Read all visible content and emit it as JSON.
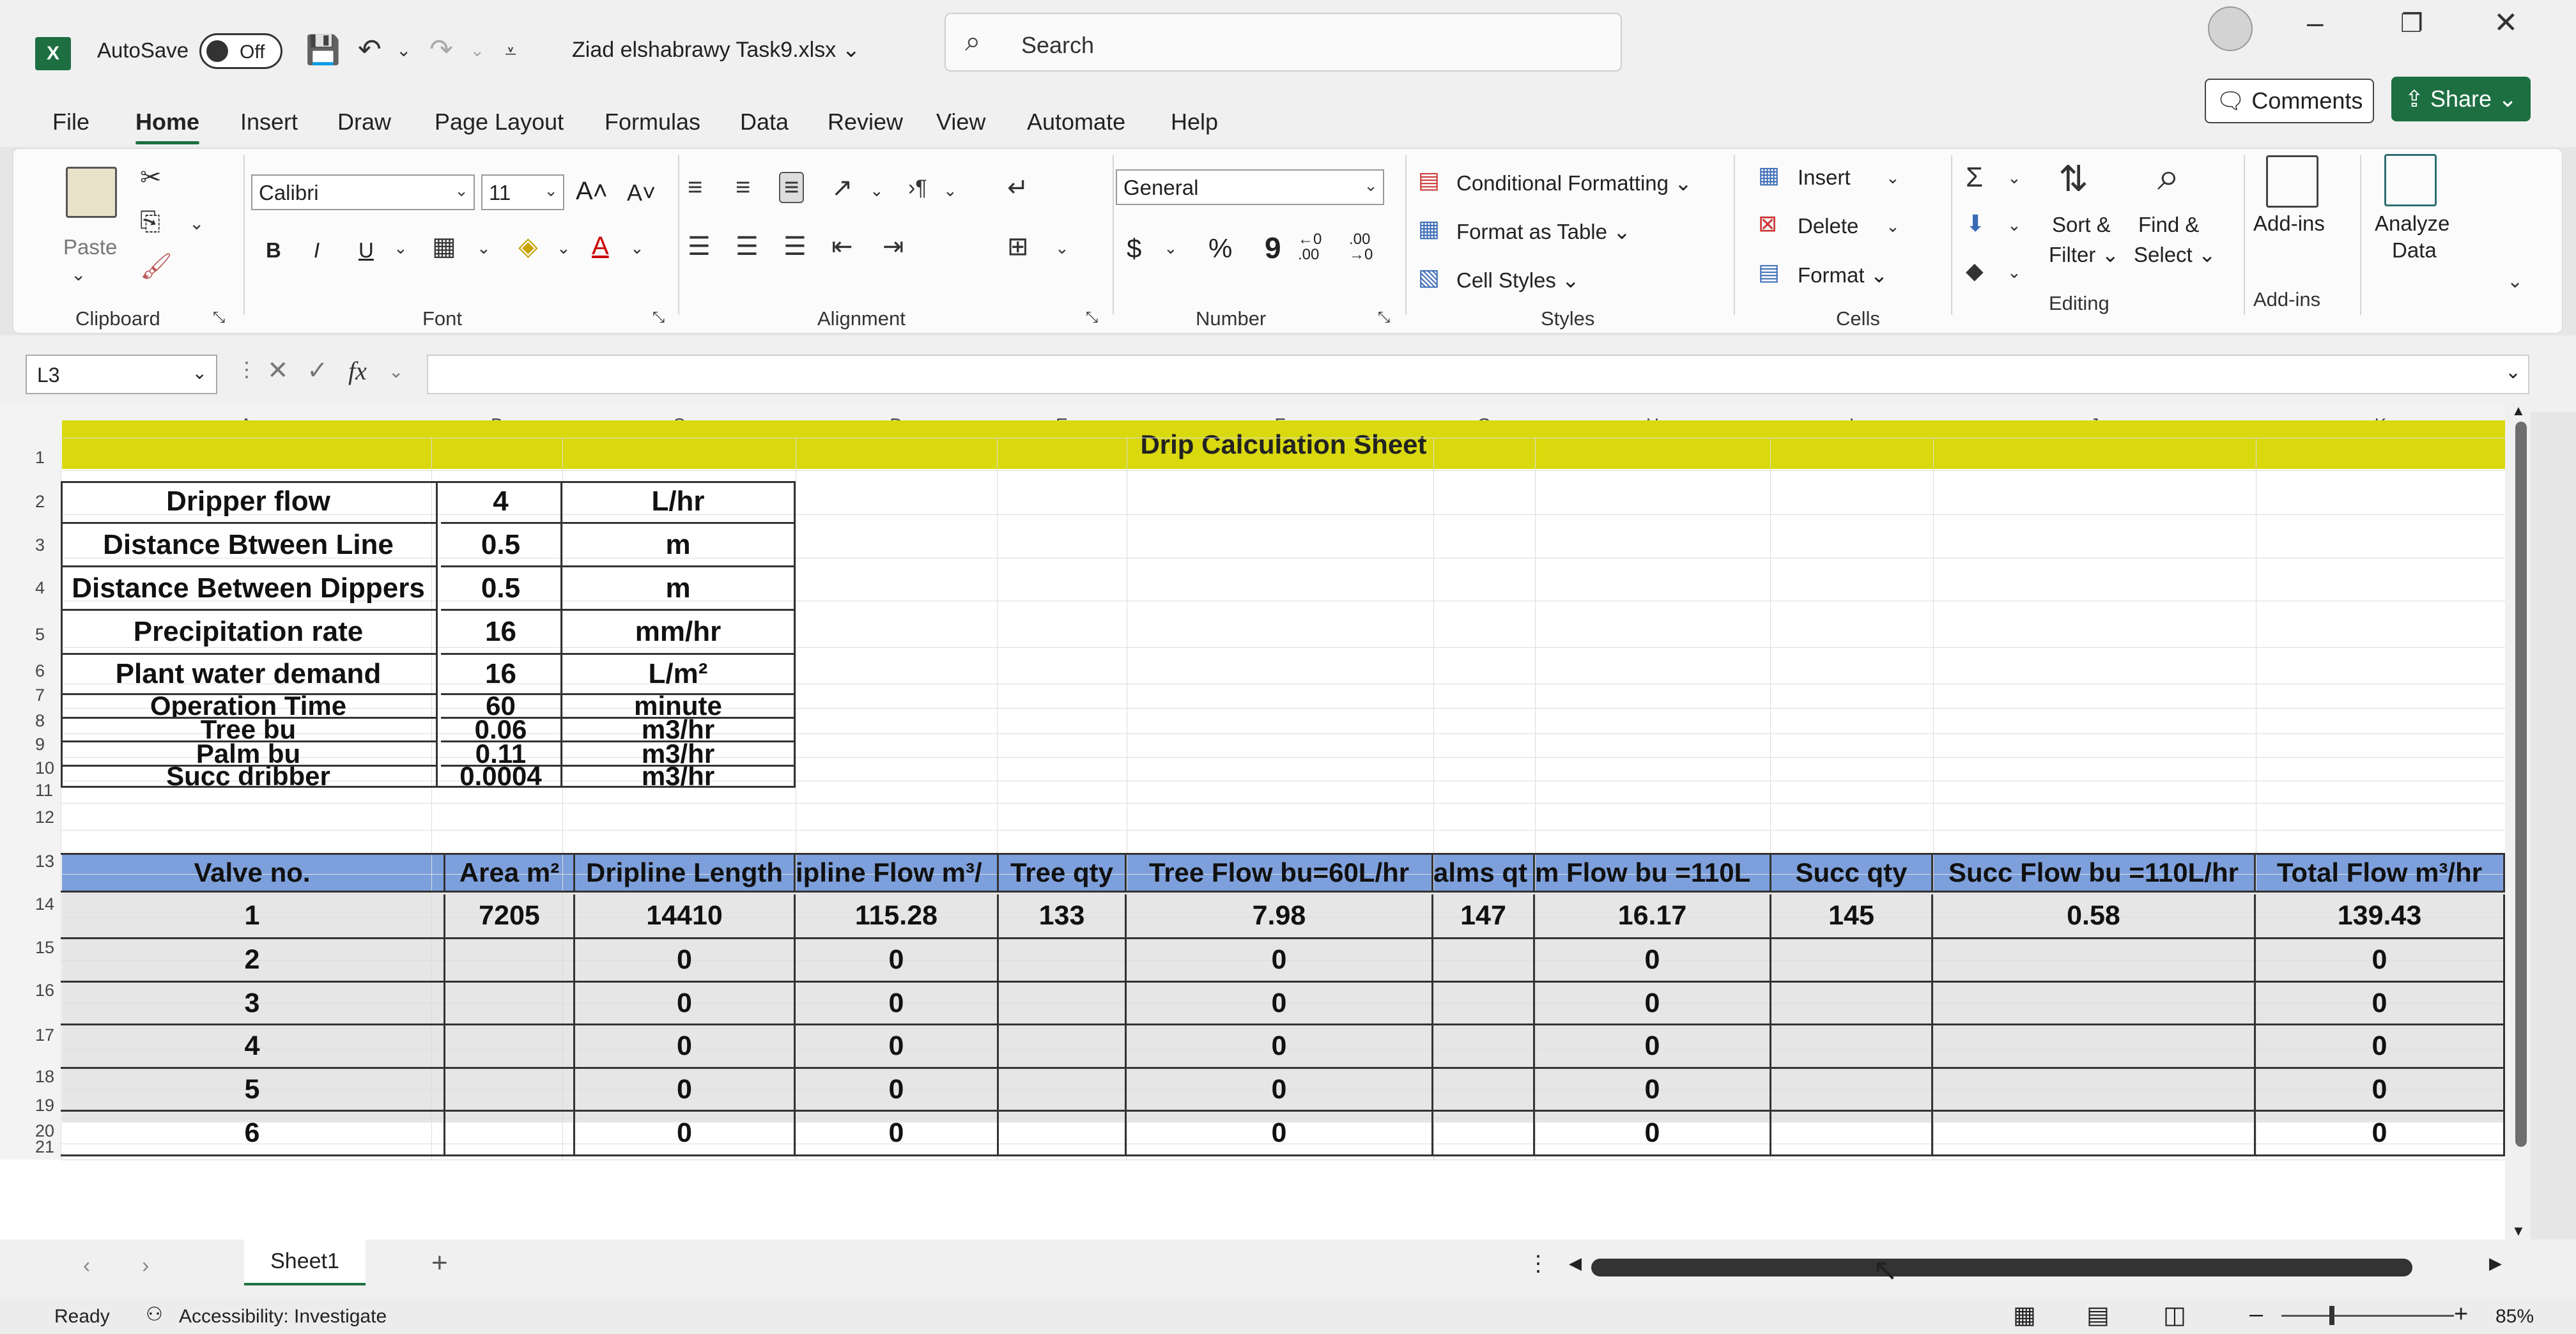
{
  "titlebar": {
    "app_icon": "X",
    "autosave_label": "AutoSave",
    "autosave_state": "Off",
    "filename": "Ziad elshabrawy Task9.xlsx",
    "search_placeholder": "Search"
  },
  "menu": {
    "tabs": [
      "File",
      "Home",
      "Insert",
      "Draw",
      "Page Layout",
      "Formulas",
      "Data",
      "Review",
      "View",
      "Automate",
      "Help"
    ],
    "active": "Home",
    "comments_label": "Comments",
    "share_label": "Share"
  },
  "ribbon": {
    "clipboard": {
      "paste": "Paste",
      "label": "Clipboard"
    },
    "font": {
      "name": "Calibri",
      "size": "11",
      "bold": "B",
      "italic": "I",
      "underline": "U",
      "label": "Font"
    },
    "alignment": {
      "label": "Alignment"
    },
    "number": {
      "format": "General",
      "currency": "$",
      "percent": "%",
      "comma": "9",
      "label": "Number"
    },
    "styles": {
      "conditional": "Conditional Formatting",
      "format_table": "Format as Table",
      "cell_styles": "Cell Styles",
      "label": "Styles"
    },
    "cells": {
      "insert": "Insert",
      "delete": "Delete",
      "format": "Format",
      "label": "Cells"
    },
    "editing": {
      "sort_filter_1": "Sort &",
      "sort_filter_2": "Filter",
      "find_select_1": "Find &",
      "find_select_2": "Select",
      "label": "Editing"
    },
    "addins": {
      "addins": "Add-ins",
      "label": "Add-ins"
    },
    "analyze": {
      "line1": "Analyze",
      "line2": "Data"
    }
  },
  "formula_bar": {
    "name_box": "L3",
    "fx": "fx",
    "value": ""
  },
  "columns": [
    "A",
    "B",
    "C",
    "D",
    "E",
    "F",
    "G",
    "H",
    "I",
    "J",
    "K"
  ],
  "rows": [
    "1",
    "2",
    "3",
    "4",
    "5",
    "6",
    "7",
    "8",
    "9",
    "10",
    "11",
    "12",
    "13",
    "14",
    "15",
    "16",
    "17",
    "18",
    "19",
    "20",
    "21"
  ],
  "sheet": {
    "title": "Drip Calculation Sheet",
    "params": [
      {
        "label": "Dripper flow",
        "value": "4",
        "unit": "L/hr"
      },
      {
        "label": "Distance Btween Line",
        "value": "0.5",
        "unit": "m"
      },
      {
        "label": "Distance Between Dippers",
        "value": "0.5",
        "unit": "m"
      },
      {
        "label": "Precipitation rate",
        "value": "16",
        "unit": "mm/hr"
      },
      {
        "label": "Plant water demand",
        "value": "16",
        "unit": "L/m²"
      },
      {
        "label": "Operation Time",
        "value": "60",
        "unit": "minute"
      },
      {
        "label": "Tree bu",
        "value": "0.06",
        "unit": "m3/hr"
      },
      {
        "label": "Palm bu",
        "value": "0.11",
        "unit": "m3/hr"
      },
      {
        "label": "Succ dribber",
        "value": "0.0004",
        "unit": "m3/hr"
      }
    ],
    "valve_headers": [
      "Valve no.",
      "Area m²",
      "Dripline Length",
      "ipline Flow m³/",
      "Tree qty",
      "Tree Flow bu=60L/hr",
      "alms qt",
      "m Flow bu =110L",
      "Succ qty",
      "Succ Flow bu =110L/hr",
      "Total Flow m³/hr"
    ],
    "valve_rows": [
      [
        "1",
        "7205",
        "14410",
        "115.28",
        "133",
        "7.98",
        "147",
        "16.17",
        "145",
        "0.58",
        "139.43"
      ],
      [
        "2",
        "",
        "0",
        "0",
        "",
        "0",
        "",
        "0",
        "",
        "",
        "0"
      ],
      [
        "3",
        "",
        "0",
        "0",
        "",
        "0",
        "",
        "0",
        "",
        "",
        "0"
      ],
      [
        "4",
        "",
        "0",
        "0",
        "",
        "0",
        "",
        "0",
        "",
        "",
        "0"
      ],
      [
        "5",
        "",
        "0",
        "0",
        "",
        "0",
        "",
        "0",
        "",
        "",
        "0"
      ],
      [
        "6",
        "",
        "0",
        "0",
        "",
        "0",
        "",
        "0",
        "",
        "",
        "0"
      ]
    ]
  },
  "sheet_tabs": {
    "tabs": [
      "Sheet1"
    ],
    "add": "+"
  },
  "status": {
    "ready": "Ready",
    "accessibility": "Accessibility: Investigate",
    "zoom": "85%"
  },
  "colors": {
    "excel_green": "#1d6f42",
    "banner_yellow": "#d9d90e",
    "header_blue": "#7da0dc",
    "table_grey": "#e6e6e6"
  }
}
